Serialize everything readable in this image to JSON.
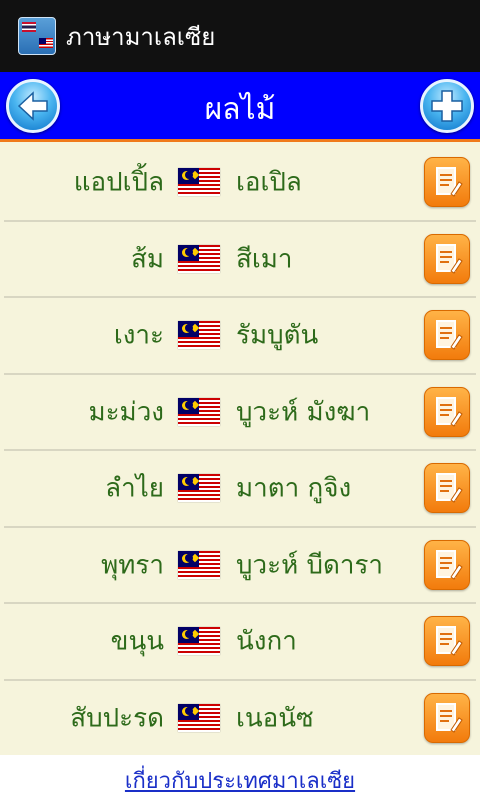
{
  "app": {
    "title": "ภาษามาเลเซีย",
    "icon_name": "app-flags-icon",
    "icon_text": "ภาษา มาเลเซีย"
  },
  "header": {
    "title": "ผลไม้",
    "back_icon": "back-arrow-icon",
    "add_icon": "plus-icon"
  },
  "colors": {
    "header_bg": "#0000ff",
    "header_border": "#f07a1a",
    "list_bg": "#f6f4dc",
    "text_green": "#2d6a1a",
    "edit_orange": "#f28c1e",
    "link_blue": "#1a2fc8"
  },
  "words": [
    {
      "thai": "แอปเปิ้ล",
      "malay": "เอเปิล"
    },
    {
      "thai": "ส้ม",
      "malay": "สีเมา"
    },
    {
      "thai": "เงาะ",
      "malay": "รัมบูตัน"
    },
    {
      "thai": "มะม่วง",
      "malay": "บูวะห์ มังฆา"
    },
    {
      "thai": "ลำไย",
      "malay": "มาตา กูจิง"
    },
    {
      "thai": "พุทรา",
      "malay": "บูวะห์ บีดารา"
    },
    {
      "thai": "ขนุน",
      "malay": "นังกา"
    },
    {
      "thai": "สับปะรด",
      "malay": "เนอนัซ"
    }
  ],
  "row_icons": {
    "flag": "malaysia-flag-icon",
    "edit": "edit-note-icon"
  },
  "footer": {
    "link": "เกี่ยวกับประเทศมาเลเซีย"
  }
}
